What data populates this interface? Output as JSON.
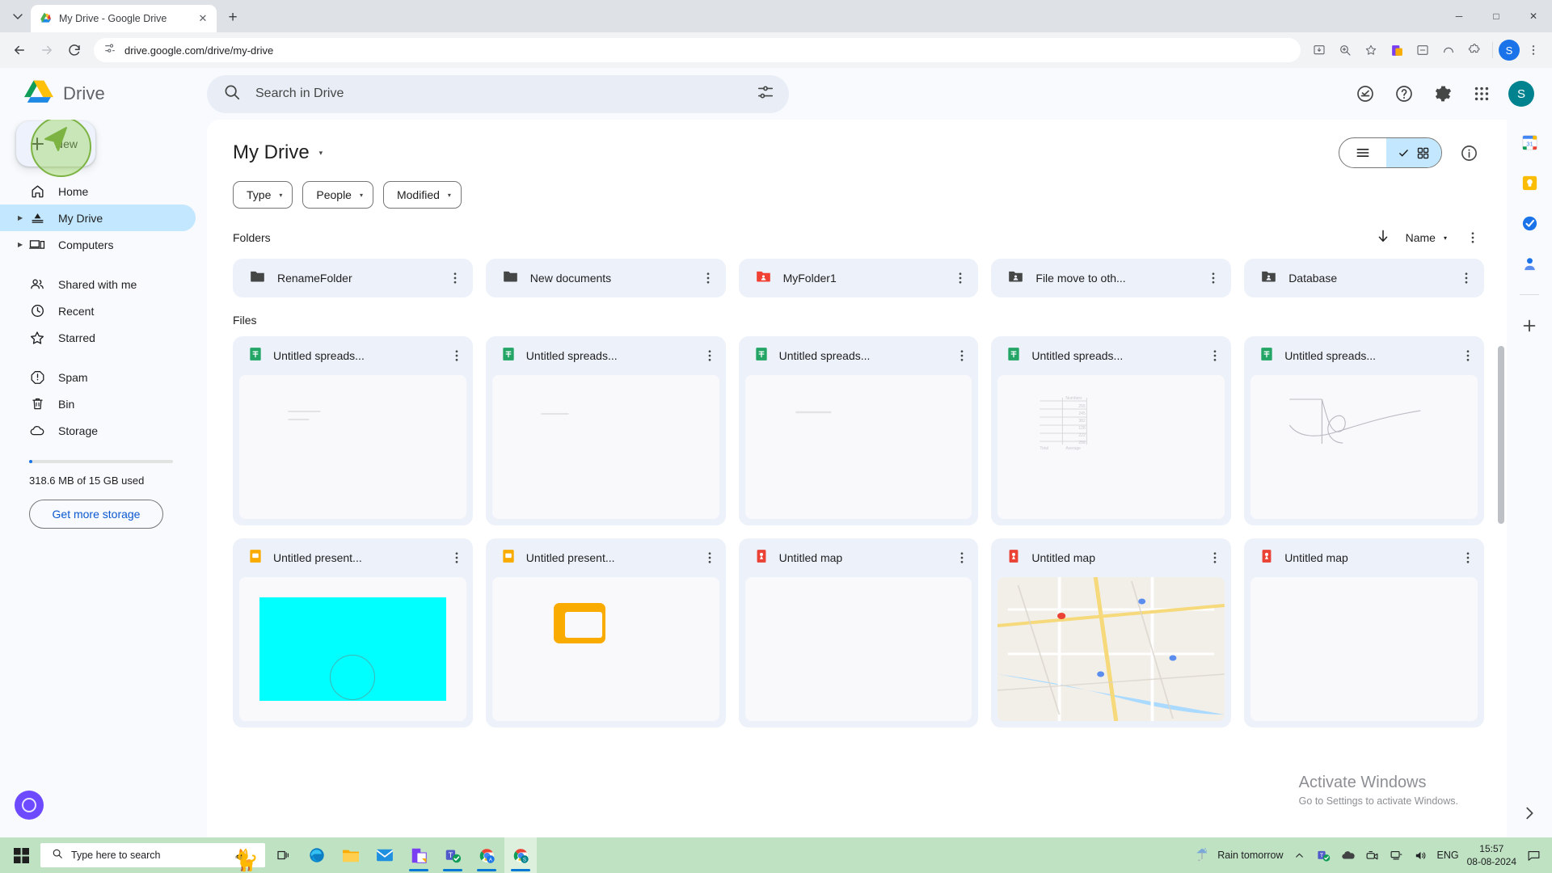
{
  "browser": {
    "tab": {
      "title": "My Drive - Google Drive",
      "favicon": "drive-icon",
      "close_label": "✕"
    },
    "new_tab_label": "+",
    "tab_list_label": "⌄",
    "window": {
      "minimize": "─",
      "maximize": "□",
      "close": "✕"
    },
    "nav": {
      "back": "←",
      "forward": "→",
      "reload": "↻"
    },
    "url": "drive.google.com/drive/my-drive",
    "profile_initial": "S"
  },
  "drive": {
    "logo_label": "drive-logo",
    "wordmark": "Drive",
    "search": {
      "placeholder": "Search in Drive",
      "value": ""
    },
    "header_icons": [
      "activity-icon",
      "help-icon",
      "settings-icon",
      "apps-grid-icon"
    ],
    "avatar_initial": "S"
  },
  "sidebar": {
    "new_button": "New",
    "items": [
      {
        "label": "Home",
        "icon": "home-icon",
        "active": false,
        "expandable": false
      },
      {
        "label": "My Drive",
        "icon": "my-drive-icon",
        "active": true,
        "expandable": true
      },
      {
        "label": "Computers",
        "icon": "computers-icon",
        "active": false,
        "expandable": true
      },
      {
        "label": "Shared with me",
        "icon": "shared-with-me-icon",
        "active": false,
        "expandable": false
      },
      {
        "label": "Recent",
        "icon": "clock-icon",
        "active": false,
        "expandable": false
      },
      {
        "label": "Starred",
        "icon": "star-icon",
        "active": false,
        "expandable": false
      },
      {
        "label": "Spam",
        "icon": "spam-icon",
        "active": false,
        "expandable": false
      },
      {
        "label": "Bin",
        "icon": "trash-icon",
        "active": false,
        "expandable": false
      },
      {
        "label": "Storage",
        "icon": "cloud-icon",
        "active": false,
        "expandable": false
      }
    ],
    "storage_text": "318.6 MB of 15 GB used",
    "storage_percent": 2,
    "get_more_storage": "Get more storage"
  },
  "main": {
    "title": "My Drive",
    "title_caret": "▾",
    "chips": [
      {
        "label": "Type",
        "caret": "▾"
      },
      {
        "label": "People",
        "caret": "▾"
      },
      {
        "label": "Modified",
        "caret": "▾"
      }
    ],
    "view_toggle": {
      "list_icon": "list-view-icon",
      "grid_icon": "grid-view-icon",
      "selected": "grid"
    },
    "info_icon": "info-icon",
    "sections": {
      "folders_label": "Folders",
      "files_label": "Files"
    },
    "sort": {
      "direction_icon": "arrow-down-icon",
      "field": "Name",
      "caret": "▾",
      "more": "more-options-icon"
    },
    "folders": [
      {
        "name": "RenameFolder",
        "icon": "folder-icon",
        "color": "#444746"
      },
      {
        "name": "New documents",
        "icon": "folder-icon",
        "color": "#444746"
      },
      {
        "name": "MyFolder1",
        "icon": "shared-folder-icon",
        "color": "#f04134"
      },
      {
        "name": "File move to oth...",
        "icon": "shared-folder-icon",
        "color": "#444746"
      },
      {
        "name": "Database",
        "icon": "shared-folder-icon",
        "color": "#444746"
      }
    ],
    "files_row1": [
      {
        "name": "Untitled spreads...",
        "icon": "sheets-icon",
        "thumb": "faint-lines"
      },
      {
        "name": "Untitled spreads...",
        "icon": "sheets-icon",
        "thumb": "faint-lines"
      },
      {
        "name": "Untitled spreads...",
        "icon": "sheets-icon",
        "thumb": "faint-lines"
      },
      {
        "name": "Untitled spreads...",
        "icon": "sheets-icon",
        "thumb": "chart-table"
      },
      {
        "name": "Untitled spreads...",
        "icon": "sheets-icon",
        "thumb": "scribble"
      }
    ],
    "files_row2": [
      {
        "name": "Untitled present...",
        "icon": "slides-icon",
        "thumb": "cyan-slide"
      },
      {
        "name": "Untitled present...",
        "icon": "slides-icon",
        "thumb": "yellow-shape"
      },
      {
        "name": "Untitled map",
        "icon": "mymaps-icon",
        "thumb": "blank"
      },
      {
        "name": "Untitled map",
        "icon": "mymaps-icon",
        "thumb": "map"
      },
      {
        "name": "Untitled map",
        "icon": "mymaps-icon",
        "thumb": "blank"
      }
    ]
  },
  "right_rail": {
    "items": [
      {
        "icon": "google-calendar-icon",
        "label": "31"
      },
      {
        "icon": "google-keep-icon",
        "label": ""
      },
      {
        "icon": "google-tasks-icon",
        "label": ""
      },
      {
        "icon": "google-contacts-icon",
        "label": ""
      }
    ],
    "add_label": "+",
    "expand_label": "›"
  },
  "watermark": {
    "title": "Activate Windows",
    "subtitle": "Go to Settings to activate Windows."
  },
  "taskbar": {
    "start_label": "start-icon",
    "search_placeholder": "Type here to search",
    "mascot": "🐈",
    "apps": [
      {
        "name": "task-view-icon",
        "running": false,
        "active": false
      },
      {
        "name": "edge-icon",
        "running": false,
        "active": false
      },
      {
        "name": "file-explorer-icon",
        "running": false,
        "active": false
      },
      {
        "name": "mail-icon",
        "running": false,
        "active": false
      },
      {
        "name": "office-icon",
        "running": true,
        "active": false
      },
      {
        "name": "teams-icon",
        "running": true,
        "active": false
      },
      {
        "name": "chrome-profile-a-icon",
        "running": true,
        "active": false
      },
      {
        "name": "chrome-profile-s-icon",
        "running": true,
        "active": true
      }
    ],
    "weather": "Rain tomorrow",
    "tray_icons": [
      "show-hidden-icon",
      "teams-tray-icon",
      "onedrive-icon",
      "camera-icon",
      "network-icon",
      "volume-icon"
    ],
    "language": "ENG",
    "time": "15:57",
    "date": "08-08-2024",
    "notification": "notification-icon"
  }
}
